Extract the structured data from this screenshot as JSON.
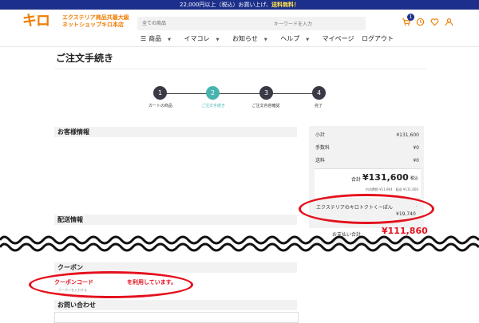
{
  "announcement": {
    "prefix": "22,000円以上（税込）お買い上げ、",
    "highlight": "送料無料！"
  },
  "logo": {
    "mark": "キロ",
    "line1": "エクステリア商品共最大級",
    "line2": "ネットショップキロ本店"
  },
  "search": {
    "category": "全ての商品",
    "placeholder": "キーワードを入力"
  },
  "header_icons": [
    {
      "icon": "cart-icon",
      "badge": "1"
    },
    {
      "icon": "history-icon"
    },
    {
      "icon": "heart-icon"
    },
    {
      "icon": "user-icon"
    }
  ],
  "nav": {
    "items": [
      "商品",
      "イマコレ",
      "お知らせ",
      "ヘルプ",
      "マイページ",
      "ログアウト"
    ]
  },
  "page_title": "ご注文手続き",
  "steps": [
    {
      "num": "1",
      "label": "カートの商品"
    },
    {
      "num": "2",
      "label": "ご注文手続き"
    },
    {
      "num": "3",
      "label": "ご注文内容確認"
    },
    {
      "num": "4",
      "label": "完了"
    }
  ],
  "active_step": 2,
  "sections": {
    "customer": "お客様情報",
    "shipping": "配送情報",
    "coupon": "クーポン",
    "inquiry": "お問い合わせ"
  },
  "summary": {
    "subtotal_label": "小計",
    "subtotal": "¥131,600",
    "fee_label": "手数料",
    "fee": "¥0",
    "shipping_label": "送料",
    "shipping": "¥0",
    "total_label": "合計",
    "total": "¥131,600",
    "tax_label": "税込",
    "total_sub": "内消費税 ¥11,964　配送 ¥131,600",
    "coupon_name": "エクステリアのキロトクトくーぽん",
    "coupon_dash": "-",
    "coupon_value": "¥19,740",
    "pay_label": "お支払い合計",
    "pay_value": "¥111,860"
  },
  "coupon_message": {
    "code_label": "クーポンコード",
    "suffix": "を利用しています。",
    "small": "クーポンを入力する"
  },
  "fragments": {
    "shipping_partial": "お届",
    "pay_partial": "お支払い合計"
  },
  "colors": {
    "brand": "#f07c00",
    "navy": "#1c2f8a",
    "accent": "#48b4b0",
    "alert": "#e4101c"
  }
}
